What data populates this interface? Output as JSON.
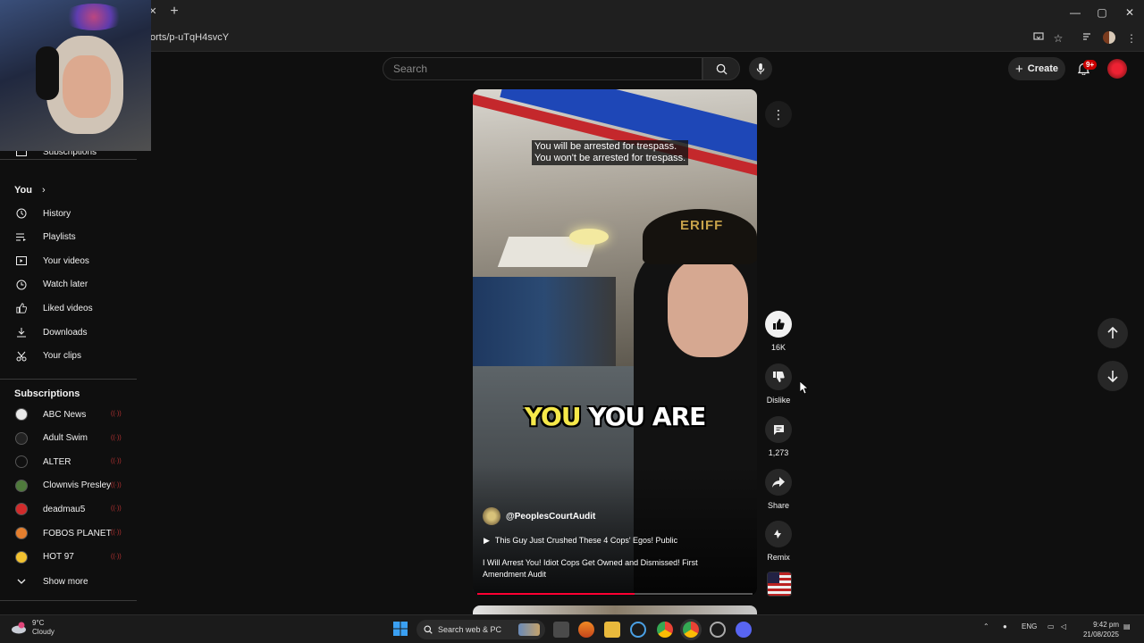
{
  "browser": {
    "url": "orts/p-uTqH4svcY",
    "window_controls": {
      "minimize": "—",
      "maximize": "▢",
      "close": "✕"
    },
    "tab_close": "✕",
    "new_tab": "+"
  },
  "header": {
    "search_placeholder": "Search",
    "create_label": "Create",
    "notification_badge": "9+"
  },
  "sidebar": {
    "subscriptions_top": "Subscriptions",
    "you_heading": "You",
    "you_items": [
      {
        "label": "History",
        "icon": "history-icon"
      },
      {
        "label": "Playlists",
        "icon": "playlists-icon"
      },
      {
        "label": "Your videos",
        "icon": "your-videos-icon"
      },
      {
        "label": "Watch later",
        "icon": "watch-later-icon"
      },
      {
        "label": "Liked videos",
        "icon": "thumbs-up-icon"
      },
      {
        "label": "Downloads",
        "icon": "download-icon"
      },
      {
        "label": "Your clips",
        "icon": "scissors-icon"
      }
    ],
    "subscriptions_heading": "Subscriptions",
    "subscriptions": [
      {
        "name": "ABC News",
        "color": "#e9e9e9"
      },
      {
        "name": "Adult Swim",
        "color": "#222222"
      },
      {
        "name": "ALTER",
        "color": "#101010"
      },
      {
        "name": "Clownvis Presley",
        "color": "#4f7a3c"
      },
      {
        "name": "deadmau5",
        "color": "#d12b2b"
      },
      {
        "name": "FOBOS PLANET",
        "color": "#e57f2e"
      },
      {
        "name": "HOT 97",
        "color": "#f2c230"
      }
    ],
    "show_more": "Show more"
  },
  "video": {
    "subtitle_line1": "You will be arrested for trespass.",
    "subtitle_line2": "You won't be arrested for trespass.",
    "cap_text": "ERIFF",
    "caption_yellow": "YOU",
    "caption_white": "YOU ARE",
    "channel": "@PeoplesCourtAudit",
    "playlist": "This Guy Just Crushed These 4 Cops' Egos! Public",
    "title": "I Will Arrest You! Idiot Cops Get Owned and Dismissed! First Amendment Audit",
    "progress": 0.57
  },
  "actions": {
    "likes": "16K",
    "dislike": "Dislike",
    "comments": "1,273",
    "share": "Share",
    "remix": "Remix"
  },
  "taskbar": {
    "temperature": "9°C",
    "condition": "Cloudy",
    "search": "Search web & PC",
    "language": "ENG",
    "time": "9:42 pm",
    "date": "21/08/2025"
  }
}
